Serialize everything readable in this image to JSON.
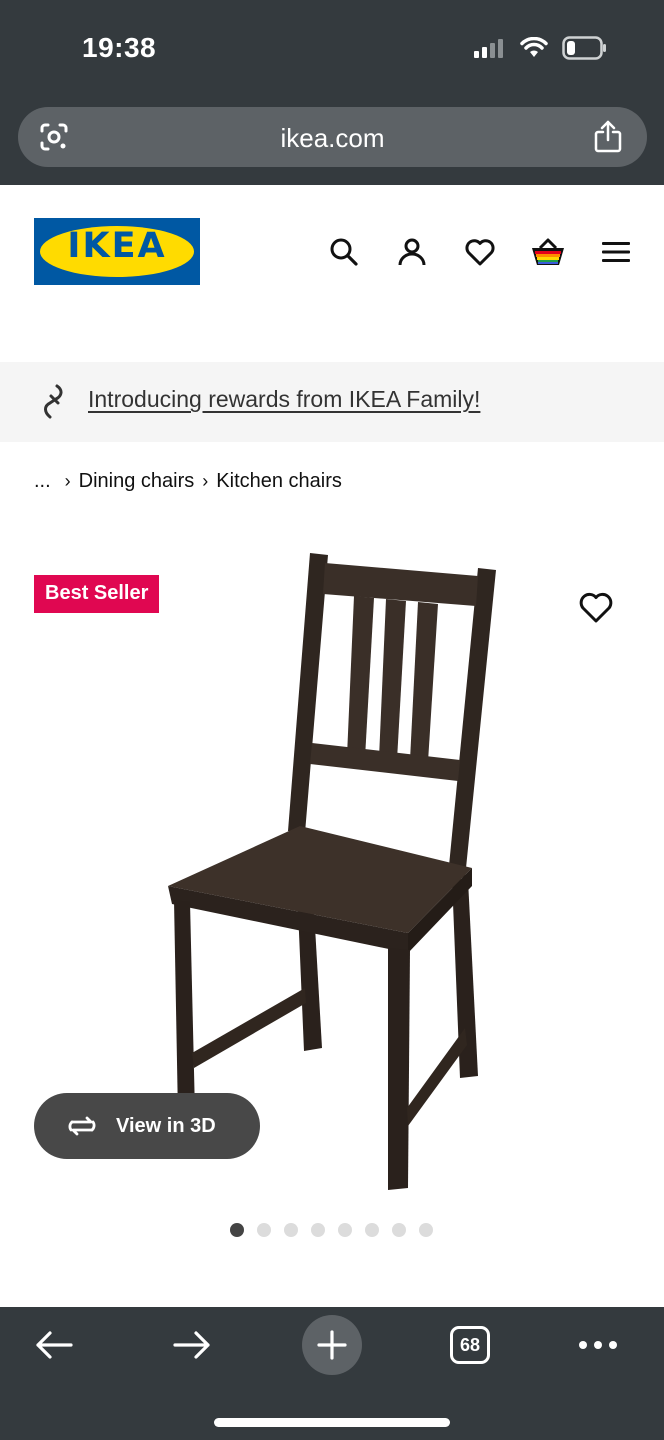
{
  "status_bar": {
    "time": "19:38",
    "icons": [
      "signal-icon",
      "wifi-icon",
      "battery-icon"
    ]
  },
  "browser": {
    "url": "ikea.com",
    "toolbar": {
      "tab_count": "68"
    }
  },
  "header": {
    "logo_text": "IKEA",
    "icons": [
      "search-icon",
      "account-icon",
      "heart-icon",
      "basket-icon",
      "menu-icon"
    ]
  },
  "banner": {
    "link_text": "Introducing rewards from IKEA Family!"
  },
  "breadcrumb": {
    "ellipsis": "...",
    "items": [
      "Dining chairs",
      "Kitchen chairs"
    ]
  },
  "product": {
    "badge": "Best Seller",
    "view_3d_label": "View in 3D",
    "image_count": 8,
    "active_image": 1
  },
  "colors": {
    "chrome": "#343a3e",
    "ikea_blue": "#0058a3",
    "ikea_yellow": "#ffdb00",
    "badge": "#e00751",
    "chair": "#3a2f28"
  }
}
